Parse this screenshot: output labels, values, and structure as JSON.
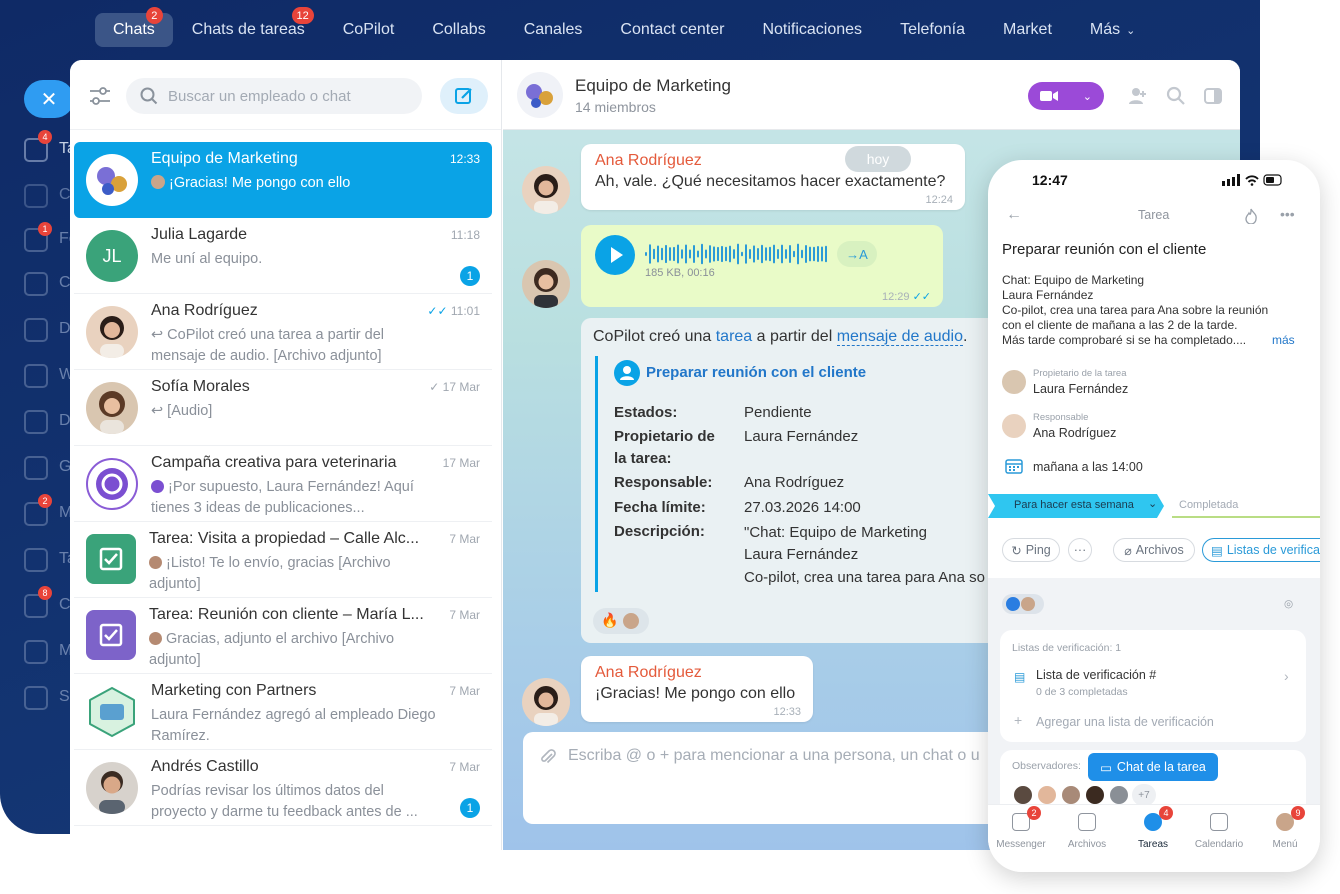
{
  "topnav": {
    "tabs": [
      {
        "label": "Chats",
        "badge": "2",
        "active": true
      },
      {
        "label": "Chats de tareas",
        "badge": "12"
      },
      {
        "label": "CoPilot"
      },
      {
        "label": "Collabs"
      },
      {
        "label": "Canales"
      },
      {
        "label": "Contact center"
      },
      {
        "label": "Notificaciones"
      },
      {
        "label": "Telefonía"
      },
      {
        "label": "Market"
      },
      {
        "label": "Más"
      }
    ]
  },
  "sidebar": {
    "labels": [
      "Ta",
      "C",
      "Fe",
      "C",
      "D",
      "W",
      "D",
      "G",
      "M",
      "Ta",
      "C",
      "M",
      "S"
    ],
    "badges": [
      "4",
      "1",
      "2",
      "8"
    ]
  },
  "search": {
    "placeholder": "Buscar un empleado o chat"
  },
  "chats": [
    {
      "name": "Equipo de Marketing",
      "time": "12:33",
      "preview": "¡Gracias! Me pongo con ello"
    },
    {
      "name": "Julia Lagarde",
      "time": "11:18",
      "preview": "Me uní al equipo.",
      "count": "1",
      "initials": "JL"
    },
    {
      "name": "Ana Rodríguez",
      "time": "11:01",
      "preview": "↩ CoPilot creó una tarea a partir del mensaje de audio. [Archivo adjunto]"
    },
    {
      "name": "Sofía Morales",
      "time": "17 Mar",
      "preview": "↩ [Audio]"
    },
    {
      "name": "Campaña creativa para veterinaria",
      "time": "17 Mar",
      "preview": "¡Por supuesto, Laura Fernández! Aquí tienes 3 ideas de publicaciones..."
    },
    {
      "name": "Tarea: Visita a propiedad – Calle Alc...",
      "time": "7 Mar",
      "preview": "¡Listo! Te lo envío, gracias [Archivo adjunto]"
    },
    {
      "name": "Tarea: Reunión con cliente – María L...",
      "time": "7 Mar",
      "preview": "Gracias, adjunto el archivo [Archivo adjunto]"
    },
    {
      "name": "Marketing con Partners",
      "time": "7 Mar",
      "preview": "Laura Fernández agregó al empleado Diego Ramírez."
    },
    {
      "name": "Andrés Castillo",
      "time": "7 Mar",
      "preview": "Podrías revisar los últimos datos del proyecto y darme tu feedback antes de ...",
      "count": "1"
    }
  ],
  "chat_header": {
    "title": "Equipo de Marketing",
    "subtitle": "14 miembros"
  },
  "messages": {
    "m1": {
      "author": "Ana Rodríguez",
      "text": "Ah, vale. ¿Qué necesitamos hacer exactamente?",
      "time": "12:24"
    },
    "today": "hoy",
    "voice": {
      "meta": "185 KB, 00:16",
      "translate": "→A",
      "time": "12:29"
    },
    "copilot": {
      "intro_a": "CoPilot creó una ",
      "link1": "tarea",
      "intro_b": " a partir del ",
      "link2": "mensaje de audio",
      "intro_c": ".",
      "task_title": "Preparar reunión con el cliente",
      "fields": [
        {
          "k": "Estados:",
          "v": "Pendiente"
        },
        {
          "k": "Propietario de",
          "v": "Laura Fernández"
        },
        {
          "k": "la tarea:",
          "v": ""
        },
        {
          "k": "Responsable:",
          "v": "Ana Rodríguez"
        },
        {
          "k": "Fecha límite:",
          "v": "27.03.2026 14:00"
        },
        {
          "k": "Descripción:",
          "v": "\"Chat: Equipo de Marketing"
        },
        {
          "k": "",
          "v": "Laura Fernández"
        },
        {
          "k": "",
          "v": "Co-pilot, crea una tarea para Ana so"
        }
      ]
    },
    "m2": {
      "author": "Ana Rodríguez",
      "text": "¡Gracias! Me pongo con ello",
      "time": "12:33"
    }
  },
  "composer": {
    "placeholder": "Escriba @ o + para mencionar a una persona, un chat o u"
  },
  "phone": {
    "time": "12:47",
    "header": "Tarea",
    "task_title": "Preparar reunión con el cliente",
    "desc": [
      "Chat: Equipo de Marketing",
      "Laura Fernández",
      "Co-pilot, crea una tarea para Ana sobre la reunión",
      "con el cliente de mañana a las 2 de la tarde.",
      "Más tarde comprobaré si se ha completado...."
    ],
    "more": "más",
    "owner_label": "Propietario de la tarea",
    "owner": "Laura Fernández",
    "resp_label": "Responsable",
    "resp": "Ana Rodríguez",
    "deadline": "mañana a las 14:00",
    "stage_active": "Para hacer esta semana",
    "stage_next": "Completada",
    "actions": [
      "Ping",
      "Archivos",
      "Listas de verifica"
    ],
    "checklists_label": "Listas de verificación: 1",
    "checklist_name": "Lista de verificación #",
    "checklist_progress": "0 de 3 completadas",
    "add_checklist": "Agregar una lista de verificación",
    "observers_label": "Observadores:",
    "task_chat_btn": "Chat de la tarea",
    "observers_more": "+7",
    "tabs": [
      {
        "label": "Messenger",
        "badge": "2"
      },
      {
        "label": "Archivos"
      },
      {
        "label": "Tareas",
        "badge": "4"
      },
      {
        "label": "Calendario"
      },
      {
        "label": "Menú",
        "badge": "9"
      }
    ]
  }
}
